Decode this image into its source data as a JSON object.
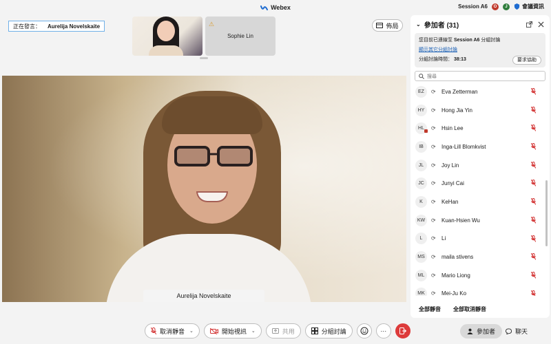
{
  "topbar": {
    "app_title": "Webex",
    "session_label": "Session A6",
    "avatar_o": "O",
    "avatar_j": "J",
    "meeting_info": "會議資訊",
    "colors": {
      "brand": "#1f6cd1",
      "avatar_o": "#c0392b",
      "avatar_j": "#2f7d3c"
    }
  },
  "speaking": {
    "prefix": "正在發言：",
    "name": "Aurelija Novelskaite"
  },
  "thumbnails": [
    {
      "name": "",
      "type": "video"
    },
    {
      "name": "Sophie Lin",
      "type": "avatar-warning"
    }
  ],
  "layout_button": "佈局",
  "main_video": {
    "name": "Aurelija Novelskaite"
  },
  "toolbar": {
    "unmute": "取消靜音",
    "start_video": "開始視訊",
    "share": "共用",
    "breakout": "分組討論",
    "reactions_icon": "smiley-icon",
    "more": "···",
    "participants": "參加者",
    "chat": "聊天"
  },
  "panel": {
    "title": "參加者 (31)",
    "session_text_prefix": "您目前已連線至",
    "session_name": "Session A6",
    "session_text_suffix": "分組討論",
    "show_other": "顯示其它分組討論",
    "time_label": "分組討論時間：",
    "time_value": "38:13",
    "help_button": "要求協助",
    "search_placeholder": "搜尋",
    "mute_all": "全部靜音",
    "unmute_all": "全部取消靜音"
  },
  "participants": [
    {
      "initials": "EZ",
      "name": "Eva Zetterman"
    },
    {
      "initials": "HY",
      "name": "Hong Jia Yin"
    },
    {
      "initials": "HL",
      "name": "Hsin Lee"
    },
    {
      "initials": "IB",
      "name": "Inga-Lill Blomkvist"
    },
    {
      "initials": "JL",
      "name": "Joy Lin"
    },
    {
      "initials": "JC",
      "name": "Junyi Cai"
    },
    {
      "initials": "K",
      "name": "KeHan"
    },
    {
      "initials": "KW",
      "name": "Kuan-Hsien Wu"
    },
    {
      "initials": "L",
      "name": "Li"
    },
    {
      "initials": "MS",
      "name": "maila stivens"
    },
    {
      "initials": "ML",
      "name": "Mario Liong"
    },
    {
      "initials": "MK",
      "name": "Mei-Ju Ko"
    }
  ]
}
